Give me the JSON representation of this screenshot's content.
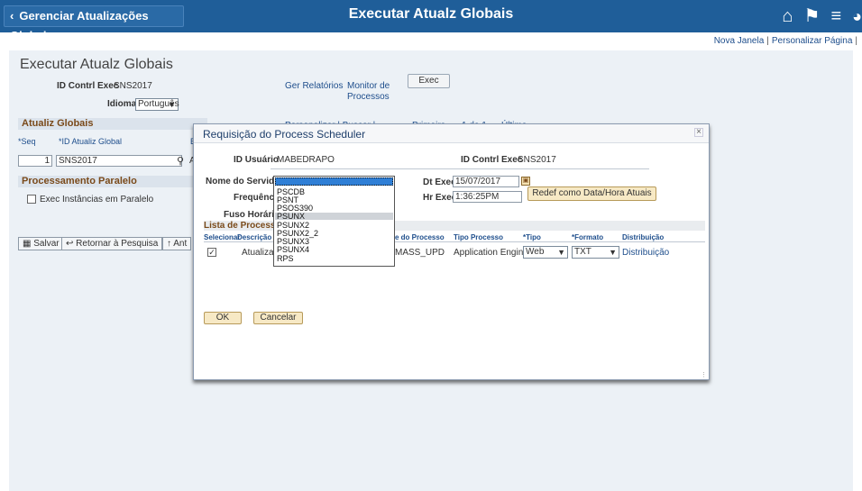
{
  "header": {
    "back_label": "Gerenciar Atualizações Globais",
    "title": "Executar Atualz Globais",
    "icons": [
      "home-icon",
      "flag-icon",
      "menu-icon",
      "navbar-icon"
    ]
  },
  "top_links": {
    "new_window": "Nova Janela",
    "customize": "Personalizar Página"
  },
  "page": {
    "title": "Executar Atualz Globais",
    "run_control_label": "ID Contrl Exec",
    "run_control_value": "SNS2017",
    "language_label": "Idioma",
    "language_value": "Português",
    "report_link": "Ger Relatórios",
    "monitor_link_1": "Monitor de",
    "monitor_link_2": "Processos",
    "exec_button": "Exec"
  },
  "global_updates": {
    "header": "Atualiz Globais",
    "seq_label": "*Seq",
    "id_label": "*ID Atualiz Global",
    "col3": "E",
    "seq_value": "1",
    "id_value": "SNS2017",
    "peek": "Personalizar | Buscar | ",
    "peek2": "Primeira",
    "peek3": "1 de 1",
    "peek4": "Última",
    "letter": "A"
  },
  "parallel": {
    "header": "Processamento Paralelo",
    "checkbox_label": "Exec Instâncias em Paralelo"
  },
  "toolbar": {
    "save": "Salvar",
    "return": "Retornar à Pesquisa",
    "prev": "Ant"
  },
  "modal": {
    "title": "Requisição do Process Scheduler",
    "user_label": "ID Usuário",
    "user_value": "MABEDRAPO",
    "run_control_label": "ID Contrl Exec",
    "run_control_value": "SNS2017",
    "server_label": "Nome do Servidor",
    "frequency_label": "Frequência",
    "timezone_label": "Fuso Horário",
    "date_label": "Dt Exec",
    "date_value": "15/07/2017",
    "time_label": "Hr Exec",
    "time_value": "1:36:25PM",
    "reset_button": "Redef como Data/Hora Atuais",
    "list_header": "Lista de Processos",
    "cols": {
      "select": "Selecionar",
      "description": "Descrição",
      "process_name": "e do Processo",
      "process_type": "Tipo Processo",
      "type": "*Tipo",
      "format": "*Formato",
      "distribution": "Distribuição"
    },
    "row": {
      "description": "Atualizaç",
      "process_name": "MASS_UPD",
      "process_type": "Application Engine",
      "type": "Web",
      "format": "TXT",
      "distribution": "Distribuição"
    },
    "ok": "OK",
    "cancel": "Cancelar",
    "server_options": [
      "",
      "PSCDB",
      "PSNT",
      "PSOS390",
      "PSUNX",
      "PSUNX2",
      "PSUNX2_2",
      "PSUNX3",
      "PSUNX4",
      "RPS"
    ],
    "selected_option": "PSUNX"
  },
  "colors": {
    "header_bg": "#1f5e99",
    "section_title": "#7a4a1a",
    "link": "#1e4e8c",
    "dropdown_highlight": "#2f7fd6"
  }
}
